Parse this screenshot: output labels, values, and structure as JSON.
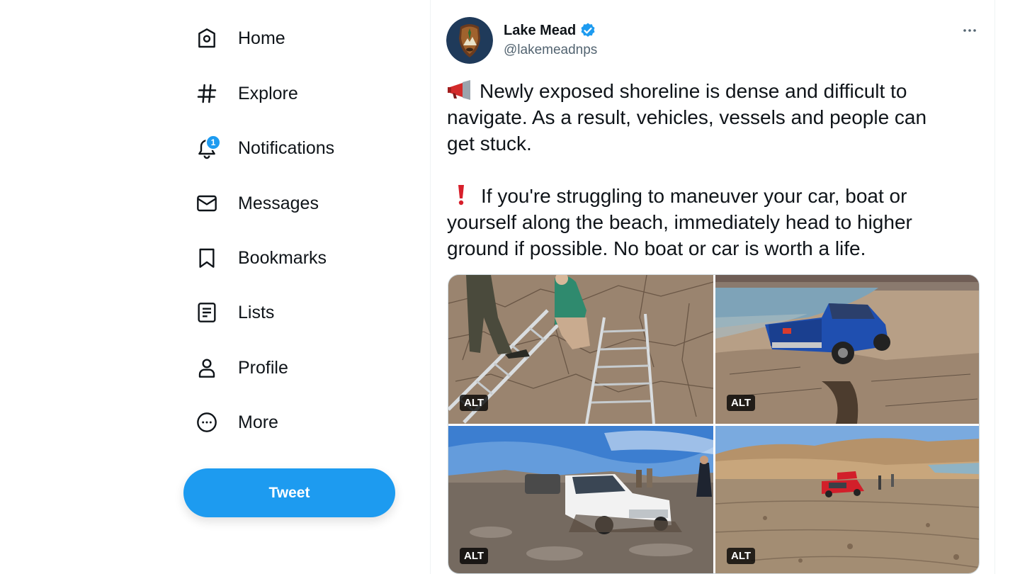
{
  "sidebar": {
    "items": [
      {
        "label": "Home",
        "icon": "home-icon"
      },
      {
        "label": "Explore",
        "icon": "hashtag-icon"
      },
      {
        "label": "Notifications",
        "icon": "bell-icon",
        "badge": "1"
      },
      {
        "label": "Messages",
        "icon": "envelope-icon"
      },
      {
        "label": "Bookmarks",
        "icon": "bookmark-icon"
      },
      {
        "label": "Lists",
        "icon": "list-icon"
      },
      {
        "label": "Profile",
        "icon": "person-icon"
      },
      {
        "label": "More",
        "icon": "more-circle-icon"
      }
    ],
    "tweet_button": "Tweet"
  },
  "tweet": {
    "author_name": "Lake Mead",
    "handle": "@lakemeadnps",
    "verified": true,
    "paragraph1": "Newly exposed shoreline is dense and difficult to\nnavigate. As a result, vehicles, vessels and people can\nget stuck.",
    "paragraph2_line1": "If you're struggling to maneuver your car, boat or",
    "paragraph2_rest": "yourself along the beach, immediately head to higher\nground if possible. No boat or car is worth a life.",
    "media": [
      {
        "alt_badge": "ALT"
      },
      {
        "alt_badge": "ALT"
      },
      {
        "alt_badge": "ALT"
      },
      {
        "alt_badge": "ALT"
      }
    ]
  },
  "colors": {
    "accent": "#1d9bf0",
    "text": "#0f1419",
    "secondary_text": "#536471",
    "border": "#eff3f4"
  }
}
